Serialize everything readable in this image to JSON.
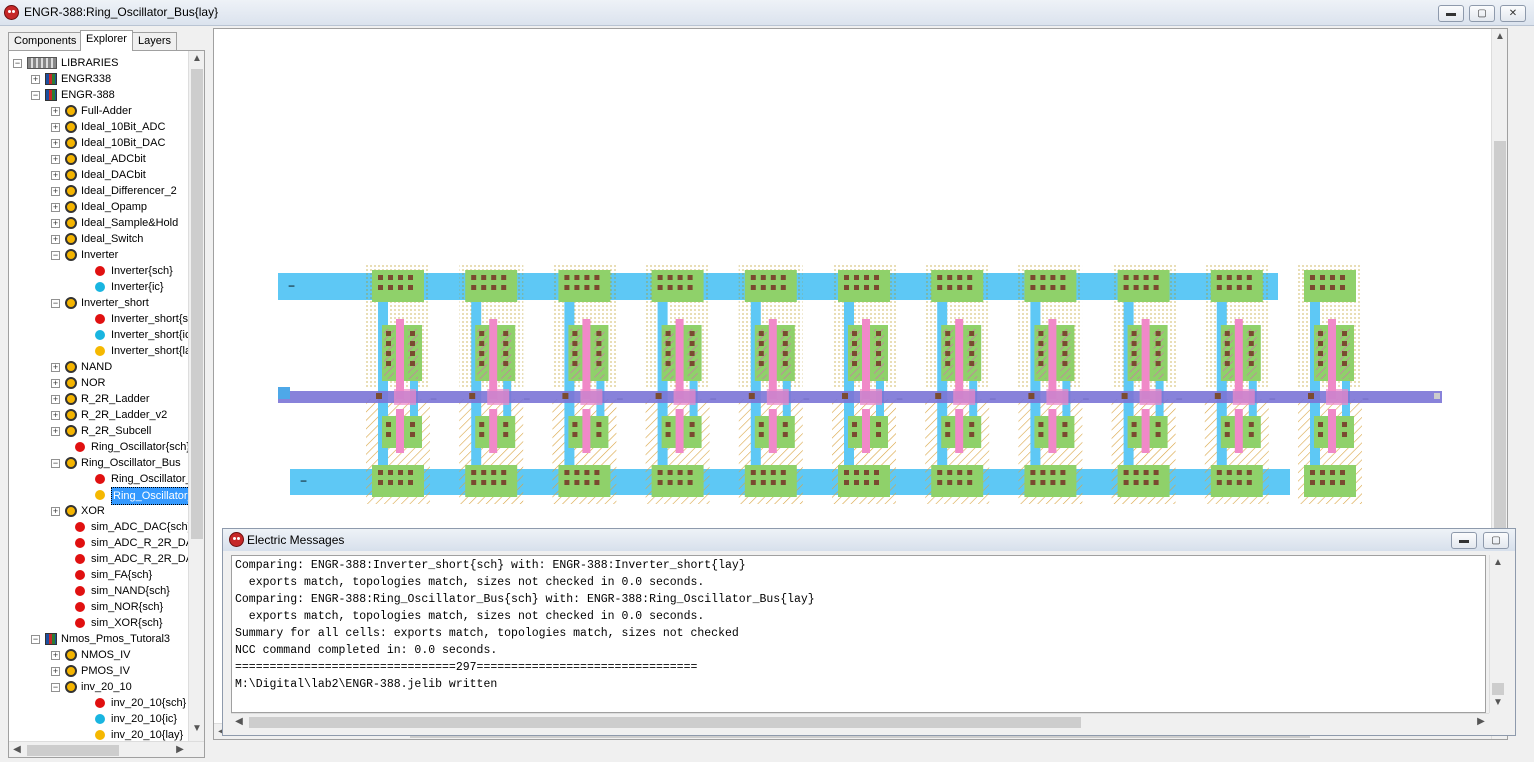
{
  "window": {
    "title": "ENGR-388:Ring_Oscillator_Bus{lay}",
    "minimize_glyph": "▬",
    "maximize_glyph": "▢",
    "close_glyph": "✕"
  },
  "explorer": {
    "tabs": [
      {
        "label": "Components",
        "active": false
      },
      {
        "label": "Explorer",
        "active": true
      },
      {
        "label": "Layers",
        "active": false
      }
    ],
    "tree": [
      {
        "label": "LIBRARIES",
        "level": 0,
        "icon": "libraries-icon",
        "expander": "−"
      },
      {
        "label": "ENGR338",
        "level": 1,
        "icon": "library-icon",
        "expander": "+"
      },
      {
        "label": "ENGR-388",
        "level": 1,
        "icon": "library-icon",
        "expander": "−"
      },
      {
        "label": "Full-Adder",
        "level": 2,
        "icon": "cell-icon",
        "expander": "+"
      },
      {
        "label": "Ideal_10Bit_ADC",
        "level": 2,
        "icon": "cell-icon",
        "expander": "+"
      },
      {
        "label": "Ideal_10Bit_DAC",
        "level": 2,
        "icon": "cell-icon",
        "expander": "+"
      },
      {
        "label": "Ideal_ADCbit",
        "level": 2,
        "icon": "cell-icon",
        "expander": "+"
      },
      {
        "label": "Ideal_DACbit",
        "level": 2,
        "icon": "cell-icon",
        "expander": "+"
      },
      {
        "label": "Ideal_Differencer_2",
        "level": 2,
        "icon": "cell-icon",
        "expander": "+"
      },
      {
        "label": "Ideal_Opamp",
        "level": 2,
        "icon": "cell-icon",
        "expander": "+"
      },
      {
        "label": "Ideal_Sample&Hold",
        "level": 2,
        "icon": "cell-icon",
        "expander": "+"
      },
      {
        "label": "Ideal_Switch",
        "level": 2,
        "icon": "cell-icon",
        "expander": "+"
      },
      {
        "label": "Inverter",
        "level": 2,
        "icon": "cell-icon",
        "expander": "−"
      },
      {
        "label": "Inverter{sch}",
        "level": 3,
        "icon": "red-dot-icon",
        "expander": ""
      },
      {
        "label": "Inverter{ic}",
        "level": 3,
        "icon": "cyan-dot-icon",
        "expander": ""
      },
      {
        "label": "Inverter_short",
        "level": 2,
        "icon": "cell-icon",
        "expander": "−"
      },
      {
        "label": "Inverter_short{s",
        "level": 3,
        "icon": "red-dot-icon",
        "expander": ""
      },
      {
        "label": "Inverter_short{ic",
        "level": 3,
        "icon": "cyan-dot-icon",
        "expander": ""
      },
      {
        "label": "Inverter_short{la",
        "level": 3,
        "icon": "orange-dot-icon",
        "expander": ""
      },
      {
        "label": "NAND",
        "level": 2,
        "icon": "cell-icon",
        "expander": "+"
      },
      {
        "label": "NOR",
        "level": 2,
        "icon": "cell-icon",
        "expander": "+"
      },
      {
        "label": "R_2R_Ladder",
        "level": 2,
        "icon": "cell-icon",
        "expander": "+"
      },
      {
        "label": "R_2R_Ladder_v2",
        "level": 2,
        "icon": "cell-icon",
        "expander": "+"
      },
      {
        "label": "R_2R_Subcell",
        "level": 2,
        "icon": "cell-icon",
        "expander": "+"
      },
      {
        "label": "Ring_Oscillator{sch}",
        "level": 2,
        "icon": "red-dot-icon",
        "expander": ""
      },
      {
        "label": "Ring_Oscillator_Bus",
        "level": 2,
        "icon": "cell-icon",
        "expander": "−"
      },
      {
        "label": "Ring_Oscillator_",
        "level": 3,
        "icon": "red-dot-icon",
        "expander": ""
      },
      {
        "label": "Ring_Oscillator_",
        "level": 3,
        "icon": "orange-dot-icon",
        "expander": "",
        "selected": true
      },
      {
        "label": "XOR",
        "level": 2,
        "icon": "cell-icon",
        "expander": "+"
      },
      {
        "label": "sim_ADC_DAC{sch}",
        "level": 2,
        "icon": "red-dot-icon",
        "expander": ""
      },
      {
        "label": "sim_ADC_R_2R_DA",
        "level": 2,
        "icon": "red-dot-icon",
        "expander": ""
      },
      {
        "label": "sim_ADC_R_2R_DA",
        "level": 2,
        "icon": "red-dot-icon",
        "expander": ""
      },
      {
        "label": "sim_FA{sch}",
        "level": 2,
        "icon": "red-dot-icon",
        "expander": ""
      },
      {
        "label": "sim_NAND{sch}",
        "level": 2,
        "icon": "red-dot-icon",
        "expander": ""
      },
      {
        "label": "sim_NOR{sch}",
        "level": 2,
        "icon": "red-dot-icon",
        "expander": ""
      },
      {
        "label": "sim_XOR{sch}",
        "level": 2,
        "icon": "red-dot-icon",
        "expander": ""
      },
      {
        "label": "Nmos_Pmos_Tutoral3",
        "level": 1,
        "icon": "library-icon",
        "expander": "−"
      },
      {
        "label": "NMOS_IV",
        "level": 2,
        "icon": "cell-icon",
        "expander": "+"
      },
      {
        "label": "PMOS_IV",
        "level": 2,
        "icon": "cell-icon",
        "expander": "+"
      },
      {
        "label": "inv_20_10",
        "level": 2,
        "icon": "cell-icon",
        "expander": "−"
      },
      {
        "label": "inv_20_10{sch}",
        "level": 3,
        "icon": "red-dot-icon",
        "expander": ""
      },
      {
        "label": "inv_20_10{ic}",
        "level": 3,
        "icon": "cyan-dot-icon",
        "expander": ""
      },
      {
        "label": "inv_20_10{lay}",
        "level": 3,
        "icon": "orange-dot-icon",
        "expander": ""
      }
    ]
  },
  "layout": {
    "stage_count": 11,
    "colors": {
      "metal1": "#5ec8f5",
      "diffusion": "#8fd16a",
      "contact": "#7a4b30",
      "poly": "#f089c8",
      "bus": "#7b74d6",
      "well_dots": "#c8a000",
      "nselect": "#d9a441"
    },
    "labels": {
      "top_left": "−",
      "bottom_left": "−",
      "bus_dash": "−"
    }
  },
  "messages": {
    "title": "Electric Messages",
    "lines": [
      "Comparing: ENGR-388:Inverter_short{sch} with: ENGR-388:Inverter_short{lay}",
      "  exports match, topologies match, sizes not checked in 0.0 seconds.",
      "Comparing: ENGR-388:Ring_Oscillator_Bus{sch} with: ENGR-388:Ring_Oscillator_Bus{lay}",
      "  exports match, topologies match, sizes not checked in 0.0 seconds.",
      "Summary for all cells: exports match, topologies match, sizes not checked",
      "NCC command completed in: 0.0 seconds.",
      "================================297================================",
      "M:\\Digital\\lab2\\ENGR-388.jelib written"
    ]
  },
  "scroll": {
    "up": "▲",
    "down": "▼",
    "left": "◀",
    "right": "▶"
  }
}
